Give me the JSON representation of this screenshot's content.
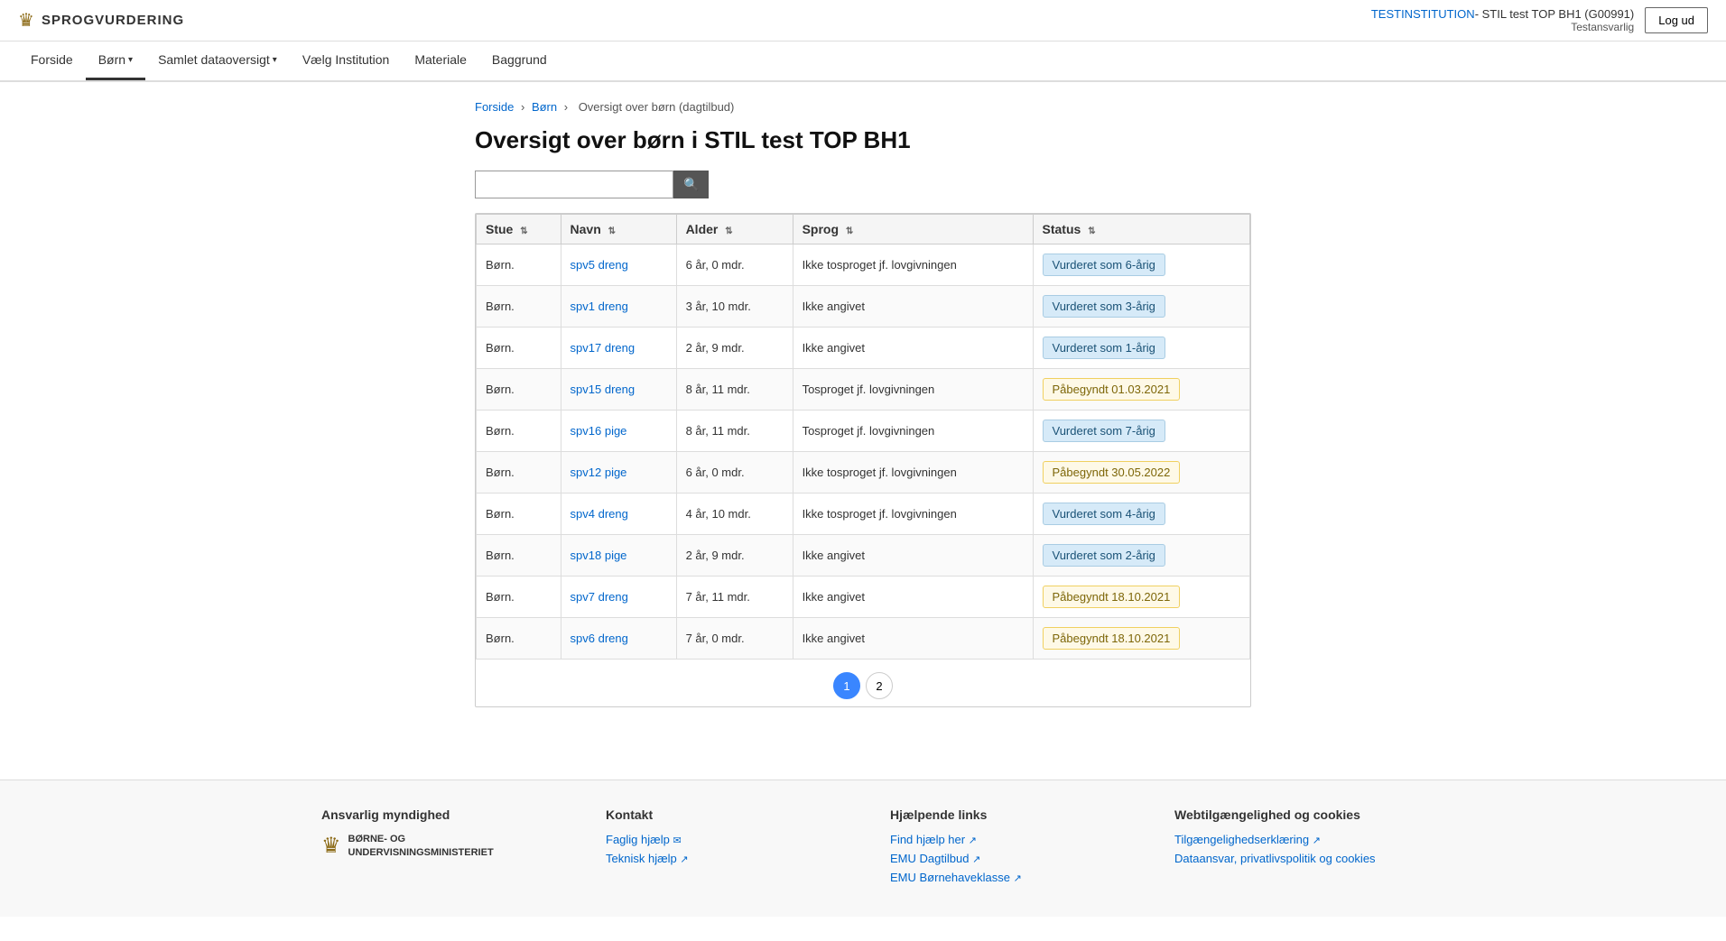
{
  "header": {
    "logo_text": "SPROGVURDERING",
    "institution_label": "TESTINSTITUTION",
    "institution_name": "- STIL test TOP BH1 (G00991)",
    "institution_role": "Testansvarlig",
    "logout_label": "Log ud"
  },
  "nav": {
    "items": [
      {
        "id": "forside",
        "label": "Forside",
        "active": false,
        "dropdown": false
      },
      {
        "id": "born",
        "label": "Børn",
        "active": true,
        "dropdown": true
      },
      {
        "id": "samlet",
        "label": "Samlet dataoversigt",
        "active": false,
        "dropdown": true
      },
      {
        "id": "vaelg",
        "label": "Vælg Institution",
        "active": false,
        "dropdown": false
      },
      {
        "id": "materiale",
        "label": "Materiale",
        "active": false,
        "dropdown": false
      },
      {
        "id": "baggrund",
        "label": "Baggrund",
        "active": false,
        "dropdown": false
      }
    ]
  },
  "breadcrumb": {
    "items": [
      {
        "label": "Forside",
        "link": true
      },
      {
        "label": "Børn",
        "link": true
      },
      {
        "label": "Oversigt over børn (dagtilbud)",
        "link": false
      }
    ]
  },
  "page": {
    "title": "Oversigt over børn i STIL test TOP BH1",
    "search_placeholder": ""
  },
  "table": {
    "columns": [
      {
        "id": "stue",
        "label": "Stue",
        "sortable": true
      },
      {
        "id": "navn",
        "label": "Navn",
        "sortable": true
      },
      {
        "id": "alder",
        "label": "Alder",
        "sortable": true
      },
      {
        "id": "sprog",
        "label": "Sprog",
        "sortable": true
      },
      {
        "id": "status",
        "label": "Status",
        "sortable": true
      }
    ],
    "rows": [
      {
        "stue": "Børn.",
        "navn": "spv5 dreng",
        "alder": "6 år, 0 mdr.",
        "sprog": "Ikke tosproget jf. lovgivningen",
        "status": "Vurderet som 6-årig",
        "status_type": "blue"
      },
      {
        "stue": "Børn.",
        "navn": "spv1 dreng",
        "alder": "3 år, 10 mdr.",
        "sprog": "Ikke angivet",
        "status": "Vurderet som 3-årig",
        "status_type": "blue"
      },
      {
        "stue": "Børn.",
        "navn": "spv17 dreng",
        "alder": "2 år, 9 mdr.",
        "sprog": "Ikke angivet",
        "status": "Vurderet som 1-årig",
        "status_type": "blue"
      },
      {
        "stue": "Børn.",
        "navn": "spv15 dreng",
        "alder": "8 år, 11 mdr.",
        "sprog": "Tosproget jf. lovgivningen",
        "status": "Påbegyndt 01.03.2021",
        "status_type": "yellow"
      },
      {
        "stue": "Børn.",
        "navn": "spv16 pige",
        "alder": "8 år, 11 mdr.",
        "sprog": "Tosproget jf. lovgivningen",
        "status": "Vurderet som 7-årig",
        "status_type": "blue"
      },
      {
        "stue": "Børn.",
        "navn": "spv12 pige",
        "alder": "6 år, 0 mdr.",
        "sprog": "Ikke tosproget jf. lovgivningen",
        "status": "Påbegyndt 30.05.2022",
        "status_type": "yellow"
      },
      {
        "stue": "Børn.",
        "navn": "spv4 dreng",
        "alder": "4 år, 10 mdr.",
        "sprog": "Ikke tosproget jf. lovgivningen",
        "status": "Vurderet som 4-årig",
        "status_type": "blue"
      },
      {
        "stue": "Børn.",
        "navn": "spv18 pige",
        "alder": "2 år, 9 mdr.",
        "sprog": "Ikke angivet",
        "status": "Vurderet som 2-årig",
        "status_type": "blue"
      },
      {
        "stue": "Børn.",
        "navn": "spv7 dreng",
        "alder": "7 år, 11 mdr.",
        "sprog": "Ikke angivet",
        "status": "Påbegyndt 18.10.2021",
        "status_type": "yellow"
      },
      {
        "stue": "Børn.",
        "navn": "spv6 dreng",
        "alder": "7 år, 0 mdr.",
        "sprog": "Ikke angivet",
        "status": "Påbegyndt 18.10.2021",
        "status_type": "yellow"
      }
    ]
  },
  "pagination": {
    "pages": [
      "1",
      "2"
    ],
    "current": "1"
  },
  "footer": {
    "col1_title": "Ansvarlig myndighed",
    "col1_logo_text": "BØRNE- OG\nUNDERVISNINGSMINISTERIET",
    "col2_title": "Kontakt",
    "col2_links": [
      {
        "label": "Faglig hjælp",
        "ext": true
      },
      {
        "label": "Teknisk hjælp",
        "ext": true
      }
    ],
    "col3_title": "Hjælpende links",
    "col3_links": [
      {
        "label": "Find hjælp her",
        "ext": true
      },
      {
        "label": "EMU Dagtilbud",
        "ext": true
      },
      {
        "label": "EMU Børnehaveklasse",
        "ext": true
      }
    ],
    "col4_title": "Webtilgængelighed og cookies",
    "col4_links": [
      {
        "label": "Tilgængeligheds­erklæring",
        "ext": true
      },
      {
        "label": "Dataansvar, privatlivspolitik og cookies",
        "ext": false
      }
    ]
  }
}
